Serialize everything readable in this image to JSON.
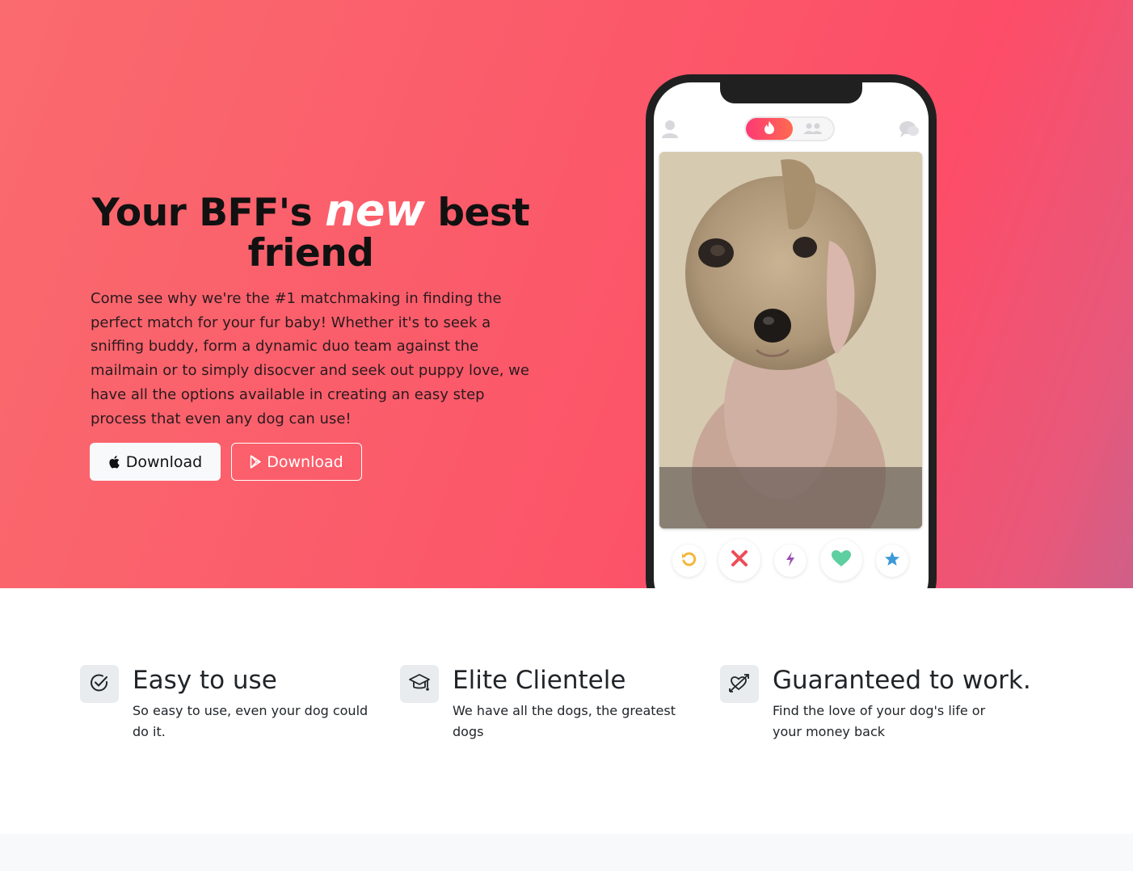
{
  "hero": {
    "title_before": "Your BFF's ",
    "title_accent": "new",
    "title_after": " best friend",
    "description": "Come see why we're the #1 matchmaking in finding the perfect match for your fur baby! Whether it's to seek a sniffing buddy, form a dynamic duo team against the mailmain or to simply disocver and seek out puppy love, we have all the options available in creating an easy step process that even any dog can use!",
    "buttons": [
      {
        "label": "Download",
        "icon": "apple-icon"
      },
      {
        "label": "Download",
        "icon": "google-play-icon"
      }
    ]
  },
  "phone": {
    "top_icons": [
      "user-icon",
      "flame-icon",
      "group-icon",
      "chat-icon"
    ],
    "photo": "dog-photo",
    "actions": [
      "rewind-icon",
      "nope-x-icon",
      "boost-bolt-icon",
      "like-heart-icon",
      "super-like-star-icon"
    ]
  },
  "features": [
    {
      "icon": "check-circle-icon",
      "title": "Easy to use",
      "text": "So easy to use, even your dog could do it."
    },
    {
      "icon": "graduation-cap-icon",
      "title": "Elite Clientele",
      "text": "We have all the dogs, the greatest dogs"
    },
    {
      "icon": "cupid-heart-arrow-icon",
      "title": "Guaranteed to work.",
      "text": "Find the love of your dog's life or your money back"
    }
  ],
  "colors": {
    "hero_gradient_start": "#fa6b6e",
    "hero_gradient_end": "#fd4d68",
    "accent_text": "#ffffff",
    "feature_icon_bg": "#e9ecef"
  }
}
